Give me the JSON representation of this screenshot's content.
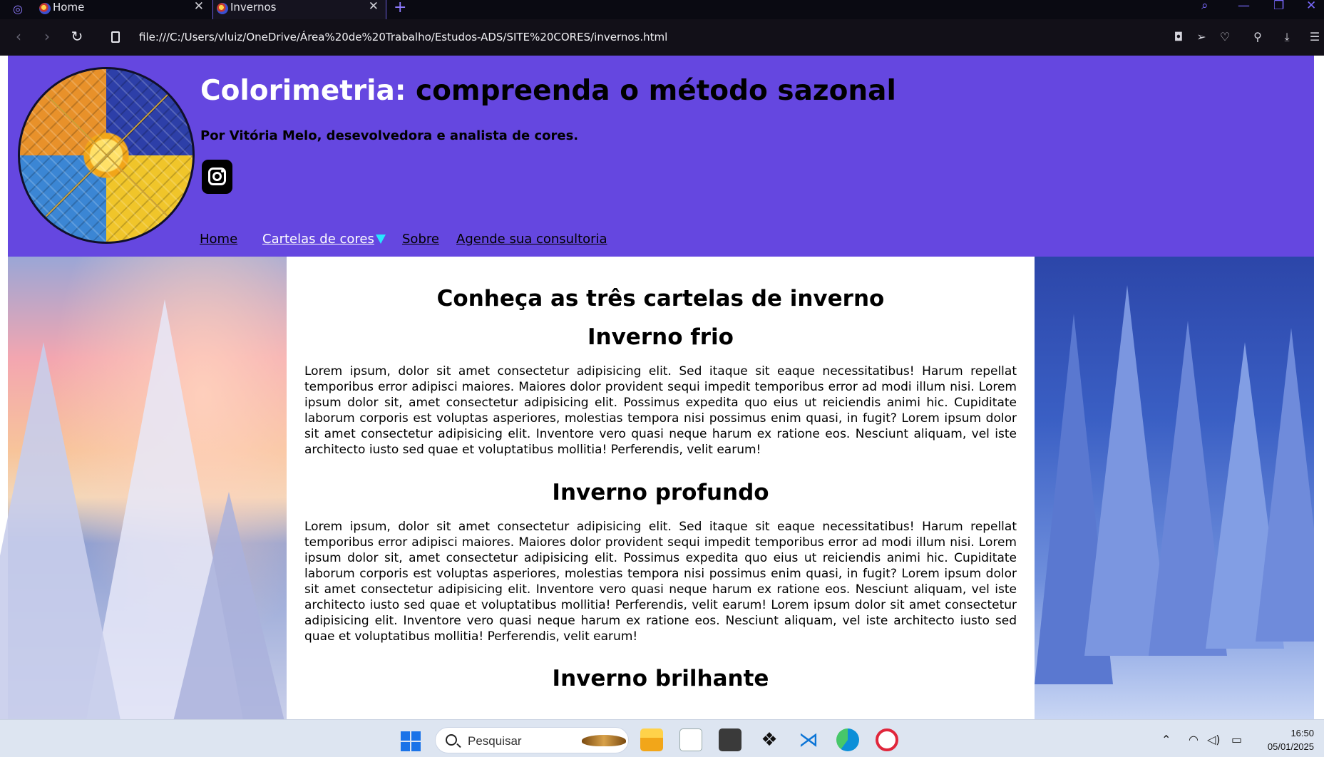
{
  "browser": {
    "tabs": [
      {
        "title": "Home",
        "active": false
      },
      {
        "title": "Invernos",
        "active": true
      }
    ],
    "url": "file:///C:/Users/vluiz/OneDrive/Área%20de%20Trabalho/Estudos-ADS/SITE%20CORES/invernos.html",
    "icons": {
      "menu": "opera-gx-icon",
      "back": "chevron-left-icon",
      "forward": "chevron-right-icon",
      "reload": "reload-icon",
      "new_tab": "plus-icon",
      "search": "search-icon",
      "minimize": "minimize-icon",
      "restore": "restore-icon",
      "close": "close-icon",
      "snapshot": "camera-icon",
      "send": "send-icon",
      "favorite": "heart-icon",
      "account": "user-icon",
      "downloads": "download-icon",
      "easy_setup": "sliders-icon"
    }
  },
  "site": {
    "title_part1": "Colorimetria:",
    "title_part2": "compreenda o método sazonal",
    "byline": "Por Vitória Melo, desevolvedora e analista de cores.",
    "colors": {
      "header_bg": "#6547e0",
      "active_link": "#ffffff",
      "caret": "#27e6ff"
    },
    "nav": [
      {
        "label": "Home"
      },
      {
        "label": "Cartelas de cores",
        "active": true,
        "has_dropdown": true
      },
      {
        "label": "Sobre"
      },
      {
        "label": "Agende sua consultoria"
      }
    ]
  },
  "content": {
    "heading": "Conheça as três cartelas de inverno",
    "sections": [
      {
        "title": "Inverno frio",
        "text": "Lorem ipsum, dolor sit amet consectetur adipisicing elit. Sed itaque sit eaque necessitatibus! Harum repellat temporibus error adipisci maiores. Maiores dolor provident sequi impedit temporibus error ad modi illum nisi. Lorem ipsum dolor sit, amet consectetur adipisicing elit. Possimus expedita quo eius ut reiciendis animi hic. Cupiditate laborum corporis est voluptas asperiores, molestias tempora nisi possimus enim quasi, in fugit? Lorem ipsum dolor sit amet consectetur adipisicing elit. Inventore vero quasi neque harum ex ratione eos. Nesciunt aliquam, vel iste architecto iusto sed quae et voluptatibus mollitia! Perferendis, velit earum!"
      },
      {
        "title": "Inverno profundo",
        "text": "Lorem ipsum, dolor sit amet consectetur adipisicing elit. Sed itaque sit eaque necessitatibus! Harum repellat temporibus error adipisci maiores. Maiores dolor provident sequi impedit temporibus error ad modi illum nisi. Lorem ipsum dolor sit, amet consectetur adipisicing elit. Possimus expedita quo eius ut reiciendis animi hic. Cupiditate laborum corporis est voluptas asperiores, molestias tempora nisi possimus enim quasi, in fugit? Lorem ipsum dolor sit amet consectetur adipisicing elit. Inventore vero quasi neque harum ex ratione eos. Nesciunt aliquam, vel iste architecto iusto sed quae et voluptatibus mollitia! Perferendis, velit earum! Lorem ipsum dolor sit amet consectetur adipisicing elit. Inventore vero quasi neque harum ex ratione eos. Nesciunt aliquam, vel iste architecto iusto sed quae et voluptatibus mollitia! Perferendis, velit earum!"
      },
      {
        "title": "Inverno brilhante",
        "text": ""
      }
    ]
  },
  "taskbar": {
    "search_placeholder": "Pesquisar",
    "apps": [
      "windows-start-icon",
      "file-explorer-icon",
      "amazon-icon",
      "sublime-text-icon",
      "dropbox-icon",
      "vscode-icon",
      "edge-icon",
      "opera-icon"
    ],
    "time": "16:50",
    "date": "05/01/2025"
  }
}
